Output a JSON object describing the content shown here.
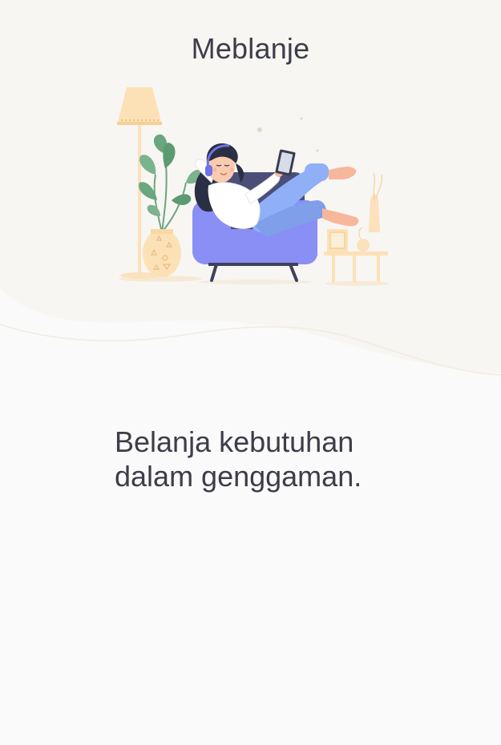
{
  "app": {
    "title": "Meblanje"
  },
  "onboarding": {
    "illustration_icon": "woman-reading-on-armchair-illustration",
    "tagline_line1": "Belanja kebutuhan",
    "tagline_line2": "dalam genggaman."
  },
  "colors": {
    "background": "#fafafa",
    "hero_background": "#f8f6f2",
    "text": "#3d3d4a",
    "armchair": "#8a8ff5",
    "accent_blue": "#8fb0f7",
    "plant_green": "#6aa67e",
    "wood": "#fbe3bd"
  }
}
